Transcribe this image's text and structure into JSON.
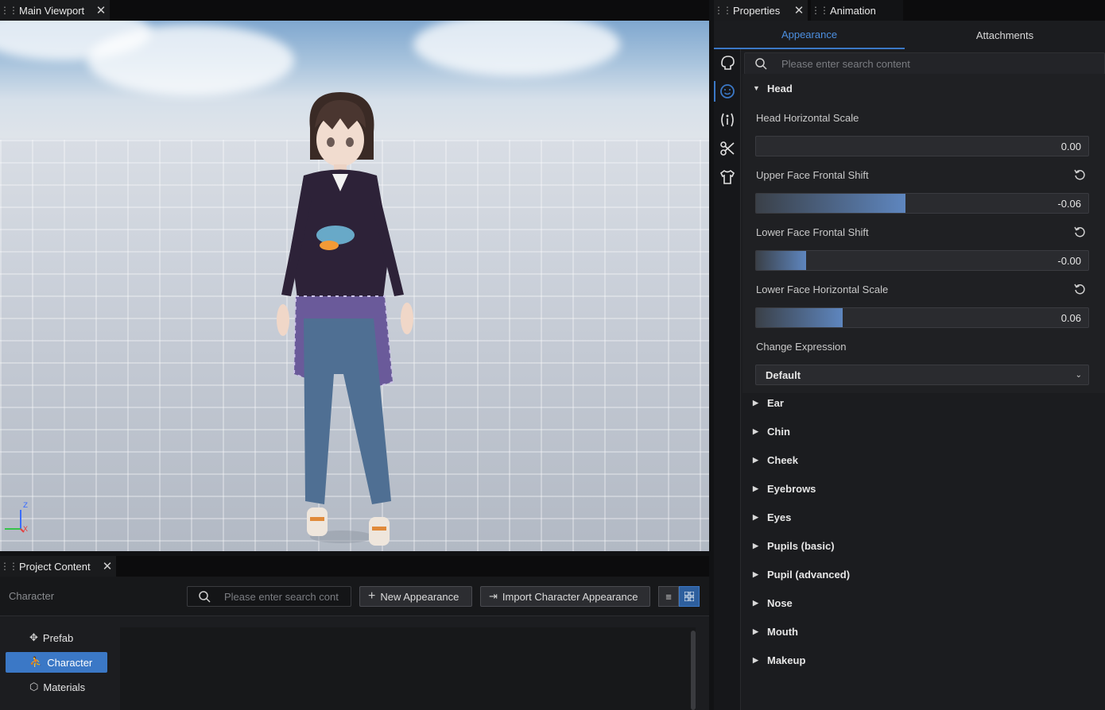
{
  "viewport_tab": {
    "title": "Main Viewport"
  },
  "viewport": {
    "axis": {
      "z": "Z",
      "x": "X"
    }
  },
  "project_tab": {
    "title": "Project Content"
  },
  "project": {
    "breadcrumb": "Character",
    "search_placeholder": "Please enter search cont",
    "new_appearance": "New Appearance",
    "import_appearance": "Import Character Appearance",
    "nav": [
      {
        "label": "Prefab",
        "icon": "prefab-icon",
        "active": false
      },
      {
        "label": "Character",
        "icon": "character-icon",
        "active": true
      },
      {
        "label": "Materials",
        "icon": "cube-icon",
        "active": false
      }
    ]
  },
  "right_tabs": {
    "properties": "Properties",
    "animation": "Animation"
  },
  "properties": {
    "tabs": [
      "Appearance",
      "Attachments"
    ],
    "search_placeholder": "Please enter search content",
    "head": {
      "label": "Head",
      "params": [
        {
          "label": "Head Horizontal Scale",
          "value": "0.00",
          "fill": 0.0,
          "reset": false
        },
        {
          "label": "Upper Face Frontal Shift",
          "value": "-0.06",
          "fill": 0.45,
          "reset": true
        },
        {
          "label": "Lower Face Frontal Shift",
          "value": "-0.00",
          "fill": 0.15,
          "reset": true
        },
        {
          "label": "Lower Face Horizontal Scale",
          "value": "0.06",
          "fill": 0.26,
          "reset": true
        }
      ],
      "expression_label": "Change Expression",
      "expression_value": "Default"
    },
    "sections": [
      "Ear",
      "Chin",
      "Cheek",
      "Eyebrows",
      "Eyes",
      "Pupils (basic)",
      "Pupil (advanced)",
      "Nose",
      "Mouth",
      "Makeup"
    ]
  },
  "colors": {
    "accent": "#3b78c6",
    "active_tab_text": "#4c8fe0"
  }
}
